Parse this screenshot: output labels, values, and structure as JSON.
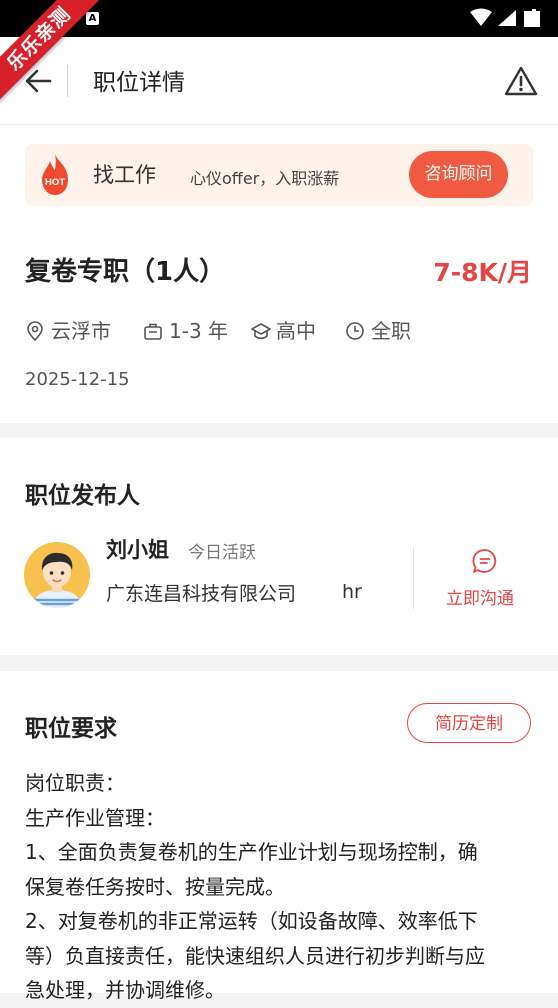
{
  "watermark": "乐乐亲测",
  "header": {
    "title": "职位详情"
  },
  "banner": {
    "title": "找工作",
    "subtitle": "心仪offer，入职涨薪",
    "button": "咨询顾问",
    "hot_text": "HOT"
  },
  "job": {
    "title": "复卷专职（1人）",
    "salary": "7-8K/月",
    "tags": [
      {
        "icon": "location-icon",
        "label": "云浮市"
      },
      {
        "icon": "briefcase-icon",
        "label": "1-3 年"
      },
      {
        "icon": "education-cap-icon",
        "label": "高中"
      },
      {
        "icon": "clock-icon",
        "label": "全职"
      }
    ],
    "date": "2025-12-15"
  },
  "publisher": {
    "section_title": "职位发布人",
    "name": "刘小姐",
    "status": "今日活跃",
    "company": "广东连昌科技有限公司",
    "role": "hr",
    "chat_label": "立即沟通"
  },
  "requirements": {
    "section_title": "职位要求",
    "resume_button": "简历定制",
    "lines": [
      "岗位职责：",
      "生产作业管理：",
      "1、全面负责复卷机的生产作业计划与现场控制，确",
      "保复卷任务按时、按量完成。",
      "2、对复卷机的非正常运转（如设备故障、效率低下",
      "等）负直接责任，能快速组织人员进行初步判断与应",
      "急处理，并协调维修。"
    ]
  },
  "colors": {
    "accent": "#e64545",
    "consult_bg": "#f05a40",
    "banner_bg": "#fdf3eb"
  }
}
